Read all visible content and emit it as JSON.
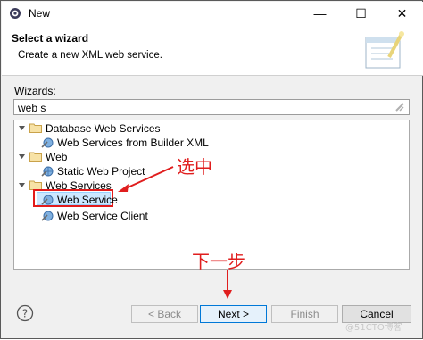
{
  "window": {
    "title": "New",
    "minimize_glyph": "—",
    "maximize_glyph": "☐",
    "close_glyph": "✕"
  },
  "header": {
    "title": "Select a wizard",
    "description": "Create a new XML web service."
  },
  "wizards": {
    "label": "Wizards:",
    "filter_value": "web s"
  },
  "tree": {
    "items": [
      {
        "label": "Database Web Services",
        "type": "folder"
      },
      {
        "label": "Web Services from Builder XML",
        "type": "leaf"
      },
      {
        "label": "Web",
        "type": "folder"
      },
      {
        "label": "Static Web Project",
        "type": "leaf"
      },
      {
        "label": "Web Services",
        "type": "folder"
      },
      {
        "label": "Web Service",
        "type": "leaf",
        "selected": true
      },
      {
        "label": "Web Service Client",
        "type": "leaf"
      }
    ]
  },
  "annotations": {
    "select": "选中",
    "next_step": "下一步"
  },
  "buttons": {
    "back": "< Back",
    "next": "Next >",
    "finish": "Finish",
    "cancel": "Cancel"
  },
  "watermark": "@51CTO博客",
  "colors": {
    "annotation": "#e01e1e",
    "selection": "#cce8ff",
    "accent": "#0078d7"
  }
}
